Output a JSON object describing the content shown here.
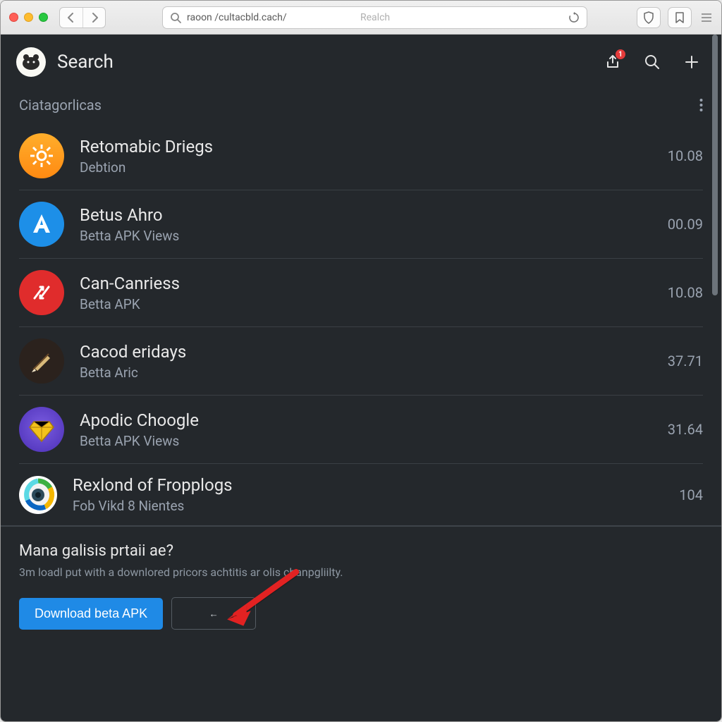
{
  "browser": {
    "address_text": "raoon /cultacbld.cach/",
    "address_placeholder": "Realch"
  },
  "app": {
    "title": "Search",
    "share_badge": "1",
    "section_label": "Ciatagorlicas",
    "items": [
      {
        "title": "Retomabic Driegs",
        "subtitle": "Debtion",
        "meta": "10.08"
      },
      {
        "title": "Betus Ahro",
        "subtitle": "Betta APK Views",
        "meta": "00.09"
      },
      {
        "title": "Can-Canriess",
        "subtitle": "Betta APK",
        "meta": "10.08"
      },
      {
        "title": "Cacod eridays",
        "subtitle": "Betta Aric",
        "meta": "37.71"
      },
      {
        "title": "Apodic Choogle",
        "subtitle": "Betta APK Views",
        "meta": "31.64"
      },
      {
        "title": "Rexlond of Fropplogs",
        "subtitle": "Fob Vikd 8 Nientes",
        "meta": "104"
      }
    ],
    "footer": {
      "title": "Mana galisis prtaii ae?",
      "subtitle": "3m loadl put with a downlored pricors achtitis ar olis chanpgliilty.",
      "primary_label": "Download beta APK",
      "secondary_label": "←"
    }
  }
}
